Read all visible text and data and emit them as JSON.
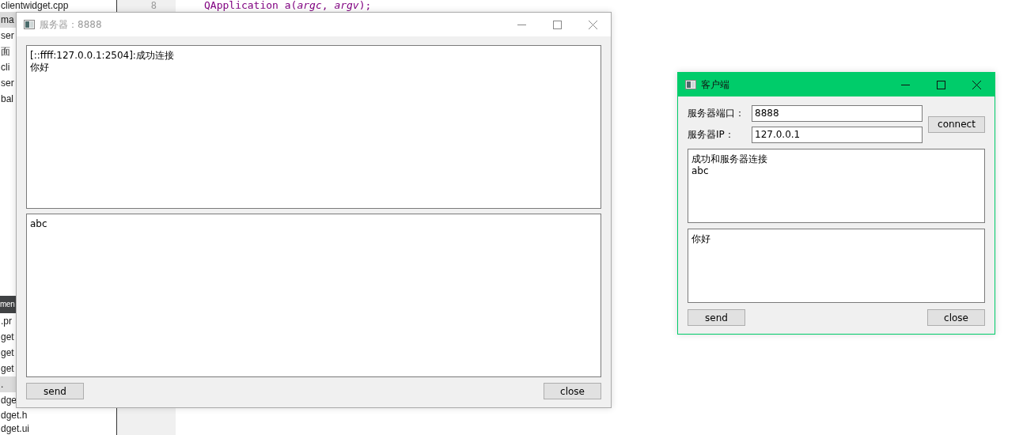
{
  "ide": {
    "file_tree": [
      {
        "label": "clientwidget.cpp",
        "selected": false
      },
      {
        "label": "ma",
        "selected": true
      },
      {
        "label": "ser",
        "selected": false
      },
      {
        "label": "面",
        "selected": false
      },
      {
        "label": "cli",
        "selected": false
      },
      {
        "label": "ser",
        "selected": false
      },
      {
        "label": "bal",
        "selected": false
      }
    ],
    "panel_header": "men",
    "file_tree_2": [
      {
        "label": ".pr",
        "selected": false
      },
      {
        "label": "get",
        "selected": false
      },
      {
        "label": "get",
        "selected": false
      },
      {
        "label": "get",
        "selected": false
      },
      {
        "label": ".",
        "selected": true
      },
      {
        "label": "dge",
        "selected": false
      },
      {
        "label": "dget.h",
        "selected": false
      },
      {
        "label": "dget.ui",
        "selected": false
      }
    ],
    "line_number": "8",
    "code_line": "QApplication a(*argc*, *argv*);"
  },
  "server_window": {
    "title": "服务器：8888",
    "active": false,
    "received_lines": [
      "[::ffff:127.0.0.1:2504]:成功连接",
      "你好"
    ],
    "send_text": "abc",
    "buttons": [
      "send",
      "close"
    ]
  },
  "client_window": {
    "title": "客户端",
    "active": true,
    "fields": [
      {
        "label": "服务器端口：",
        "value": "8888"
      },
      {
        "label": "服务器IP：",
        "value": "127.0.0.1"
      }
    ],
    "connect_button": "connect",
    "received_lines": [
      "成功和服务器连接",
      "abc"
    ],
    "send_text": "你好",
    "buttons": [
      "send",
      "close"
    ]
  }
}
